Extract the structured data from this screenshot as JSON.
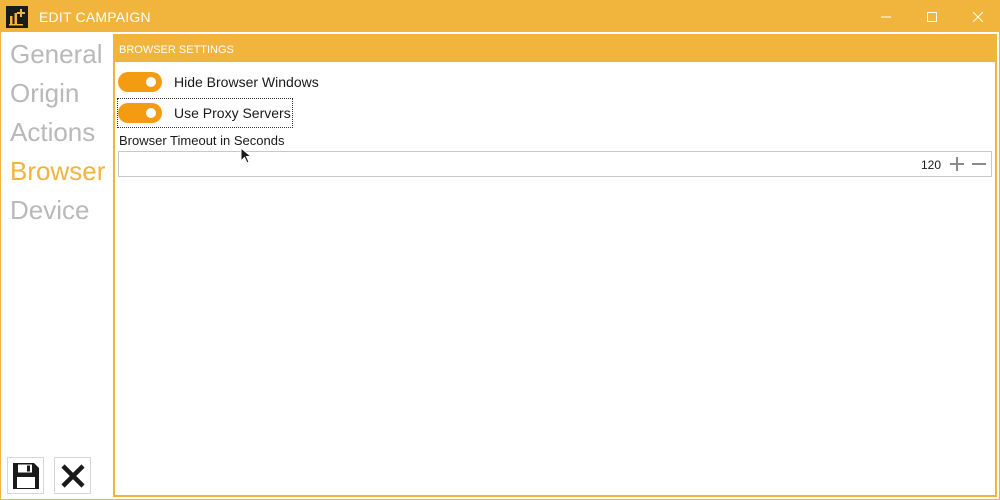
{
  "window": {
    "title": "EDIT CAMPAIGN",
    "app_icon": "chart-plus-icon",
    "accent_color": "#F1B43D",
    "toggle_color": "#F39C12"
  },
  "sidebar": {
    "items": [
      {
        "label": "General",
        "active": false
      },
      {
        "label": "Origin",
        "active": false
      },
      {
        "label": "Actions",
        "active": false
      },
      {
        "label": "Browser",
        "active": true
      },
      {
        "label": "Device",
        "active": false
      }
    ],
    "save_icon": "save-icon",
    "cancel_icon": "close-icon"
  },
  "browser_settings": {
    "section_title": "BROWSER SETTINGS",
    "hide_windows": {
      "label": "Hide Browser Windows",
      "on": true
    },
    "use_proxy": {
      "label": "Use Proxy Servers",
      "on": true
    },
    "timeout": {
      "label": "Browser Timeout in Seconds",
      "value": "120"
    }
  }
}
